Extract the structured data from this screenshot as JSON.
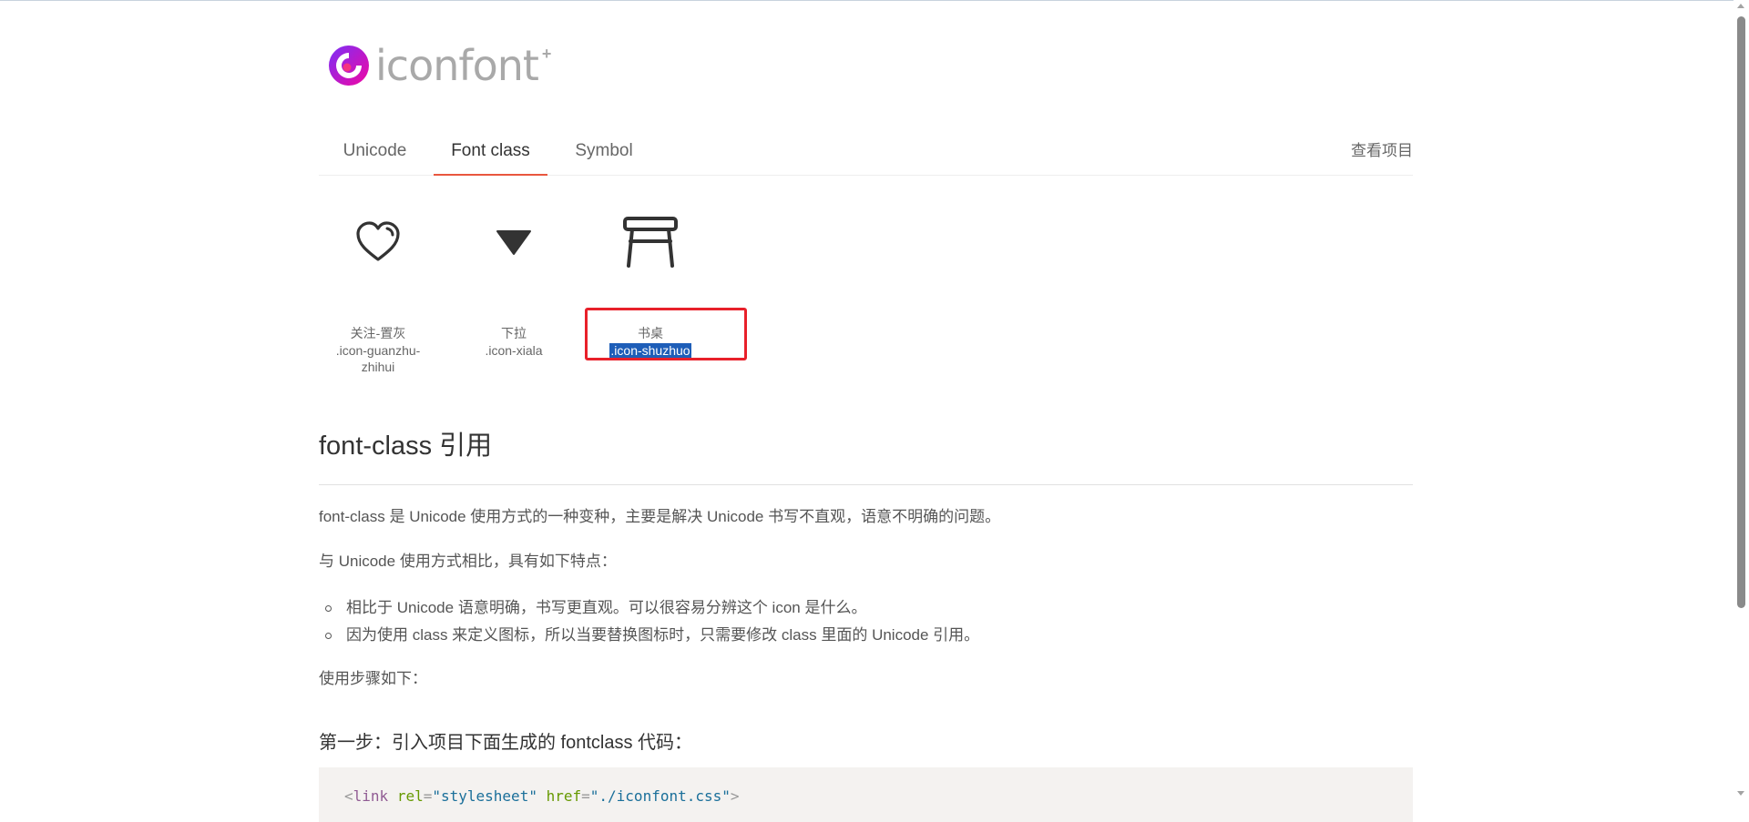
{
  "logo": {
    "text": "iconfont",
    "plus": "+"
  },
  "tabs": [
    {
      "label": "Unicode",
      "active": false
    },
    {
      "label": "Font class",
      "active": true
    },
    {
      "label": "Symbol",
      "active": false
    }
  ],
  "view_project_link": "查看项目",
  "icons": [
    {
      "icon": "heart-outline-icon",
      "name": "关注-置灰",
      "code": ".icon-guanzhu-zhihui",
      "selected": false
    },
    {
      "icon": "triangle-down-icon",
      "name": "下拉",
      "code": ".icon-xiala",
      "selected": false
    },
    {
      "icon": "desk-icon",
      "name": "书桌",
      "code": ".icon-shuzhuo",
      "selected": true
    }
  ],
  "article": {
    "heading": "font-class 引用",
    "intro": "font-class 是 Unicode 使用方式的一种变种，主要是解决 Unicode 书写不直观，语意不明确的问题。",
    "compare": "与 Unicode 使用方式相比，具有如下特点：",
    "features": [
      "相比于 Unicode 语意明确，书写更直观。可以很容易分辨这个 icon 是什么。",
      "因为使用 class 来定义图标，所以当要替换图标时，只需要修改 class 里面的 Unicode 引用。"
    ],
    "steps_label": "使用步骤如下：",
    "step1_heading": "第一步：引入项目下面生成的 fontclass 代码：",
    "code": {
      "open": "<",
      "tag": "link",
      "attr1": "rel",
      "eq1": "=",
      "val1": "\"stylesheet\"",
      "attr2": "href",
      "eq2": "=",
      "val2": "\"./iconfont.css\"",
      "close": ">"
    }
  },
  "colors": {
    "tab_underline": "#e9573f",
    "highlight_box": "#e8202a",
    "selection": "#1e5eb8",
    "logo_gradient_start": "#7b2ff7",
    "logo_gradient_end": "#f107a3"
  }
}
